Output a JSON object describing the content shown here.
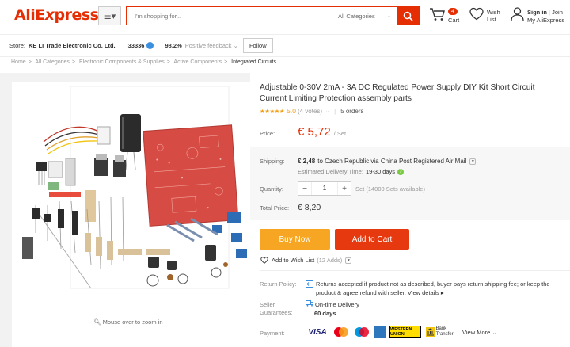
{
  "header": {
    "logo": "AliExpress",
    "search_placeholder": "I'm shopping for...",
    "category_select": "All Categories",
    "cart_count": "4",
    "cart_label": "Cart",
    "wish_label": "Wish List",
    "signin": "Sign in",
    "join": "Join",
    "my_account": "My AliExpress"
  },
  "store": {
    "label": "Store:",
    "name": "KE LI Trade Electronic Co. Ltd.",
    "rating": "33336",
    "positive_pct": "98.2%",
    "feedback_label": "Positive feedback",
    "follow": "Follow"
  },
  "breadcrumb": [
    "Home",
    "All Categories",
    "Electronic Components & Supplies",
    "Active Components",
    "Integrated Circuits"
  ],
  "gallery": {
    "zoom_hint": "Mouse over to zoom in"
  },
  "product": {
    "title": "Adjustable 0-30V 2mA - 3A DC Regulated Power Supply DIY Kit Short Circuit Current Limiting Protection assembly parts",
    "stars": "★★★★★",
    "rating": "5.0",
    "votes": "(4 votes)",
    "orders": "5 orders",
    "price_label": "Price:",
    "price": "€ 5,72",
    "price_unit": "/ Set",
    "shipping_label": "Shipping:",
    "shipping_cost": "€ 2,48",
    "shipping_text": "to Czech Republic via China Post Registered Air Mail",
    "delivery_label": "Estimated Delivery Time:",
    "delivery_days": "19-30 days",
    "quantity_label": "Quantity:",
    "quantity": "1",
    "available": "Set (14000 Sets available)",
    "total_label": "Total Price:",
    "total": "€ 8,20",
    "buy_now": "Buy Now",
    "add_to_cart": "Add to Cart",
    "wishlist": "Add to Wish List",
    "wishlist_count": "(12 Adds)"
  },
  "policies": {
    "return_label": "Return Policy:",
    "return_text": "Returns accepted if product not as described, buyer pays return shipping fee; or keep the product & agree refund with seller.",
    "return_more": "View details",
    "guarantee_label": "Seller Guarantees:",
    "guarantee_text": "On-time Delivery",
    "guarantee_days": "60 days",
    "payment_label": "Payment:",
    "payment_visa": "VISA",
    "payment_wu": "WESTERN UNION",
    "payment_bank": "Bank Transfer",
    "payment_more": "View More"
  },
  "colors": {
    "brand": "#e62e04",
    "buy_now": "#f6a623",
    "add_to_cart": "#e6390f",
    "star": "#f39c12"
  }
}
